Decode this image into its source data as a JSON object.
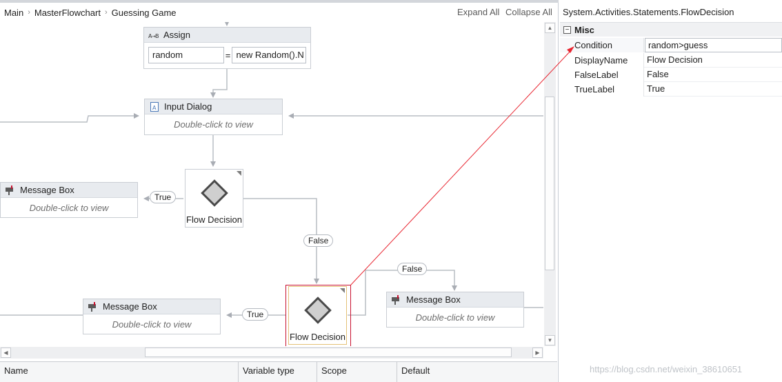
{
  "breadcrumb": [
    "Main",
    "MasterFlowchart",
    "Guessing Game"
  ],
  "toolbar": {
    "expand_all": "Expand All",
    "collapse_all": "Collapse All"
  },
  "assign": {
    "title": "Assign",
    "to_value": "random",
    "equals": "=",
    "expression": "new Random().N"
  },
  "input_dialog": {
    "title": "Input Dialog",
    "hint": "Double-click to view"
  },
  "decision_1": {
    "label": "Flow Decision"
  },
  "decision_2": {
    "label": "Flow Decision"
  },
  "msgbox_left": {
    "title": "Message Box",
    "hint": "Double-click to view"
  },
  "msgbox_bottom_left": {
    "title": "Message Box",
    "hint": "Double-click to view"
  },
  "msgbox_right": {
    "title": "Message Box",
    "hint": "Double-click to view"
  },
  "labels": {
    "true_1": "True",
    "false_1": "False",
    "true_2": "True",
    "false_2": "False"
  },
  "variables_grid": {
    "columns": [
      "Name",
      "Variable type",
      "Scope",
      "Default"
    ]
  },
  "properties": {
    "type_name": "System.Activities.Statements.FlowDecision",
    "category": "Misc",
    "toggle_glyph": "−",
    "rows": [
      {
        "name": "Condition",
        "value": "random>guess"
      },
      {
        "name": "DisplayName",
        "value": "Flow Decision"
      },
      {
        "name": "FalseLabel",
        "value": "False"
      },
      {
        "name": "TrueLabel",
        "value": "True"
      }
    ]
  },
  "watermark": "https://blog.csdn.net/weixin_38610651",
  "colors": {
    "annotation_red": "#e8242f",
    "highlight_border": "#c8102e",
    "selected_border": "#e4c176",
    "wire": "#b9bdc4"
  },
  "icons": {
    "assign": "assign-ab-icon",
    "input_dialog": "dialog-document-icon",
    "message_box": "message-mailbox-icon",
    "decision": "decision-diamond-icon"
  }
}
